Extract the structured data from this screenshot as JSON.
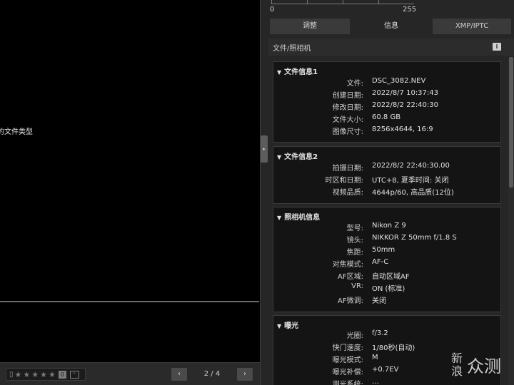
{
  "left": {
    "unsupported_text": "的文件类型",
    "rating": {
      "icon": "label-icon",
      "stars": [
        "★",
        "★",
        "★",
        "★",
        "★"
      ],
      "count": "0",
      "label_badge": "L"
    },
    "pager": {
      "prev": "‹",
      "text": "2 / 4",
      "next": "›"
    }
  },
  "divider": {
    "toggle": "▸"
  },
  "right": {
    "histogram": {
      "min": "0",
      "max": "255"
    },
    "tabs": [
      "调整",
      "信息",
      "XMP/IPTC"
    ],
    "active_tab": "信息",
    "subhead": {
      "title": "文件/照相机",
      "info_icon": "i"
    },
    "sections": [
      {
        "title": "文件信息1",
        "rows": [
          {
            "k": "文件:",
            "v": "DSC_3082.NEV"
          },
          {
            "k": "创建日期:",
            "v": "2022/8/7 10:37:43"
          },
          {
            "k": "修改日期:",
            "v": "2022/8/2 22:40:30"
          },
          {
            "k": "文件大小:",
            "v": "60.8 GB"
          },
          {
            "k": "图像尺寸:",
            "v": "8256x4644, 16:9"
          }
        ]
      },
      {
        "title": "文件信息2",
        "rows": [
          {
            "k": "拍摄日期:",
            "v": "2022/8/2 22:40:30.00"
          },
          {
            "k": "时区和日期:",
            "v": "UTC+8, 夏季时间: 关闭"
          },
          {
            "k": "视频品质:",
            "v": "4644p/60, 高品质(12位)"
          }
        ]
      },
      {
        "title": "照相机信息",
        "rows": [
          {
            "k": "型号:",
            "v": "Nikon Z 9"
          },
          {
            "k": "镜头:",
            "v": "NIKKOR Z 50mm f/1.8 S"
          },
          {
            "k": "焦距:",
            "v": "50mm"
          },
          {
            "k": "对焦模式:",
            "v": "AF-C"
          },
          {
            "k": "AF区域:",
            "v": "自动区域AF"
          },
          {
            "k": "VR:",
            "v": "ON (标准)"
          },
          {
            "k": "AF微调:",
            "v": "关闭"
          }
        ]
      },
      {
        "title": "曝光",
        "rows": [
          {
            "k": "光圈:",
            "v": "f/3.2"
          },
          {
            "k": "快门速度:",
            "v": "1/80秒(自动)"
          },
          {
            "k": "曝光模式:",
            "v": "M"
          },
          {
            "k": "曝光补偿:",
            "v": "+0.7EV"
          },
          {
            "k": "测光系统:",
            "v": "…"
          }
        ]
      }
    ]
  },
  "watermark": {
    "line1": "新浪",
    "line2": "众测"
  }
}
